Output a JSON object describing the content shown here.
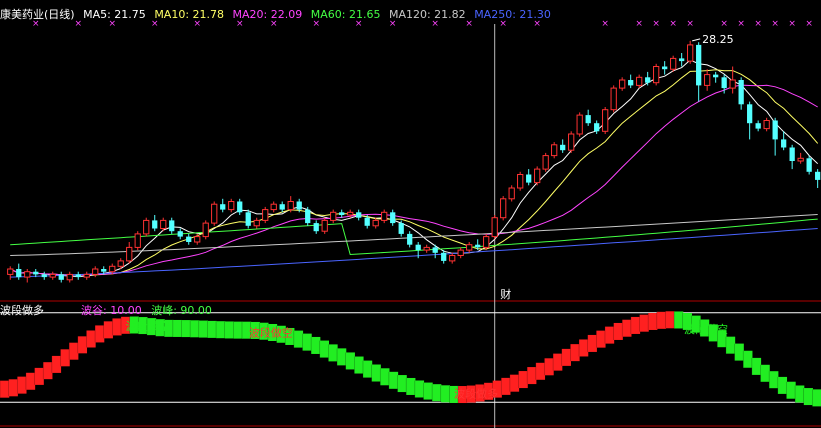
{
  "header": {
    "stock_label": "康美药业(日线)",
    "ma": [
      {
        "label": "MA5: 21.75",
        "color": "#ffffff"
      },
      {
        "label": "MA10: 21.78",
        "color": "#ffff66"
      },
      {
        "label": "MA20: 22.09",
        "color": "#ff44ff"
      },
      {
        "label": "MA60: 21.65",
        "color": "#44ff44"
      },
      {
        "label": "MA120: 21.82",
        "color": "#c8c8c8"
      },
      {
        "label": "MA250: 21.30",
        "color": "#4a64ff"
      }
    ]
  },
  "indicator": {
    "name": "波段做多",
    "trough": "波谷: 10.00",
    "peak": "波峰: 90.00",
    "trough_color": "#ff44ff",
    "peak_color": "#44ff44"
  },
  "colors": {
    "up": "#ff3232",
    "down": "#54ffff",
    "bg": "#000000",
    "frame": "#b00000",
    "ind_up": "#ff2020",
    "ind_down": "#22ee22"
  },
  "chart_data": [
    {
      "type": "candlestick",
      "title": "康美药业(日线)",
      "ylim": [
        18.8,
        28.8
      ],
      "high_label": "28.25",
      "event_marker": "财",
      "signal_marker": "×",
      "candles": [
        [
          19.6,
          19.8,
          19.4,
          19.9
        ],
        [
          19.8,
          19.5,
          19.4,
          20.0
        ],
        [
          19.5,
          19.7,
          19.3,
          19.8
        ],
        [
          19.7,
          19.6,
          19.5,
          19.8
        ],
        [
          19.6,
          19.5,
          19.4,
          19.7
        ],
        [
          19.5,
          19.6,
          19.4,
          19.7
        ],
        [
          19.6,
          19.4,
          19.3,
          19.7
        ],
        [
          19.4,
          19.6,
          19.3,
          19.7
        ],
        [
          19.6,
          19.5,
          19.4,
          19.7
        ],
        [
          19.5,
          19.6,
          19.4,
          19.7
        ],
        [
          19.6,
          19.8,
          19.5,
          19.9
        ],
        [
          19.8,
          19.7,
          19.6,
          19.9
        ],
        [
          19.7,
          19.9,
          19.6,
          20.0
        ],
        [
          19.9,
          20.1,
          19.8,
          20.2
        ],
        [
          20.1,
          20.6,
          20.0,
          20.8
        ],
        [
          20.6,
          21.1,
          20.5,
          21.2
        ],
        [
          21.1,
          21.6,
          21.0,
          21.7
        ],
        [
          21.6,
          21.3,
          21.2,
          21.8
        ],
        [
          21.3,
          21.6,
          21.2,
          21.7
        ],
        [
          21.6,
          21.2,
          21.1,
          21.7
        ],
        [
          21.2,
          21.0,
          20.9,
          21.3
        ],
        [
          21.0,
          20.8,
          20.7,
          21.1
        ],
        [
          20.8,
          21.0,
          20.7,
          21.1
        ],
        [
          21.0,
          21.5,
          20.9,
          21.6
        ],
        [
          21.5,
          22.2,
          21.4,
          22.3
        ],
        [
          22.2,
          22.0,
          21.9,
          22.4
        ],
        [
          22.0,
          22.3,
          21.9,
          22.4
        ],
        [
          22.3,
          21.9,
          21.8,
          22.4
        ],
        [
          21.9,
          21.4,
          21.3,
          22.0
        ],
        [
          21.4,
          21.6,
          21.3,
          21.7
        ],
        [
          21.6,
          22.0,
          21.5,
          22.1
        ],
        [
          22.0,
          22.2,
          21.9,
          22.3
        ],
        [
          22.2,
          22.0,
          21.9,
          22.3
        ],
        [
          22.0,
          22.3,
          21.9,
          22.5
        ],
        [
          22.3,
          22.0,
          21.9,
          22.4
        ],
        [
          22.0,
          21.5,
          21.4,
          22.1
        ],
        [
          21.5,
          21.2,
          21.1,
          21.6
        ],
        [
          21.2,
          21.6,
          21.1,
          21.7
        ],
        [
          21.6,
          21.9,
          21.5,
          22.0
        ],
        [
          21.9,
          21.8,
          21.7,
          22.0
        ],
        [
          21.8,
          21.9,
          21.7,
          22.0
        ],
        [
          21.9,
          21.7,
          21.6,
          22.0
        ],
        [
          21.7,
          21.4,
          21.3,
          21.8
        ],
        [
          21.4,
          21.6,
          21.3,
          21.7
        ],
        [
          21.6,
          21.9,
          21.5,
          22.0
        ],
        [
          21.9,
          21.5,
          21.4,
          22.0
        ],
        [
          21.5,
          21.1,
          21.0,
          21.6
        ],
        [
          21.1,
          20.7,
          20.6,
          21.2
        ],
        [
          20.7,
          20.5,
          20.2,
          20.8
        ],
        [
          20.5,
          20.6,
          20.4,
          20.7
        ],
        [
          20.6,
          20.4,
          20.2,
          20.7
        ],
        [
          20.4,
          20.1,
          20.0,
          20.5
        ],
        [
          20.1,
          20.3,
          20.0,
          20.4
        ],
        [
          20.3,
          20.5,
          20.2,
          20.6
        ],
        [
          20.5,
          20.7,
          20.4,
          20.8
        ],
        [
          20.7,
          20.6,
          20.5,
          20.9
        ],
        [
          20.6,
          21.0,
          20.5,
          21.1
        ],
        [
          21.0,
          21.7,
          20.9,
          21.8
        ],
        [
          21.7,
          22.4,
          21.6,
          22.5
        ],
        [
          22.4,
          22.8,
          22.3,
          22.9
        ],
        [
          22.8,
          23.3,
          22.7,
          23.4
        ],
        [
          23.3,
          23.0,
          22.9,
          23.5
        ],
        [
          23.0,
          23.5,
          22.9,
          23.6
        ],
        [
          23.5,
          24.0,
          23.4,
          24.1
        ],
        [
          24.0,
          24.4,
          23.9,
          24.5
        ],
        [
          24.4,
          24.2,
          24.1,
          24.6
        ],
        [
          24.2,
          24.8,
          24.1,
          24.9
        ],
        [
          24.8,
          25.5,
          24.7,
          25.6
        ],
        [
          25.5,
          25.2,
          25.1,
          25.7
        ],
        [
          25.2,
          24.9,
          24.8,
          25.3
        ],
        [
          24.9,
          25.7,
          24.8,
          25.8
        ],
        [
          25.7,
          26.5,
          25.6,
          26.6
        ],
        [
          26.5,
          26.8,
          26.4,
          26.9
        ],
        [
          26.8,
          26.6,
          26.5,
          27.0
        ],
        [
          26.6,
          26.9,
          26.5,
          27.0
        ],
        [
          26.9,
          26.7,
          26.6,
          27.1
        ],
        [
          26.7,
          27.3,
          26.6,
          27.4
        ],
        [
          27.3,
          27.2,
          27.0,
          27.5
        ],
        [
          27.2,
          27.6,
          27.1,
          27.7
        ],
        [
          27.6,
          27.5,
          27.3,
          27.8
        ],
        [
          27.5,
          28.1,
          27.4,
          28.25
        ],
        [
          28.1,
          26.6,
          26.0,
          28.2
        ],
        [
          26.6,
          27.0,
          26.4,
          27.2
        ],
        [
          27.0,
          26.9,
          26.7,
          27.1
        ],
        [
          26.9,
          26.5,
          26.3,
          27.0
        ],
        [
          26.5,
          26.8,
          26.3,
          27.3
        ],
        [
          26.8,
          25.9,
          25.7,
          26.9
        ],
        [
          25.9,
          25.2,
          24.6,
          26.0
        ],
        [
          25.2,
          25.0,
          24.9,
          25.3
        ],
        [
          25.0,
          25.3,
          24.9,
          25.4
        ],
        [
          25.3,
          24.6,
          24.0,
          25.4
        ],
        [
          24.6,
          24.3,
          24.2,
          24.9
        ],
        [
          24.3,
          23.8,
          23.5,
          24.4
        ],
        [
          23.8,
          23.9,
          23.7,
          24.1
        ],
        [
          23.9,
          23.4,
          23.3,
          24.0
        ],
        [
          23.4,
          23.1,
          22.8,
          23.5
        ]
      ],
      "ma_values": {
        "MA5": 21.75,
        "MA10": 21.78,
        "MA20": 22.09,
        "MA60": 21.65,
        "MA120": 21.82,
        "MA250": 21.3
      }
    },
    {
      "type": "bar",
      "title": "波段做多",
      "ylim": [
        0,
        100
      ],
      "trough": 10.0,
      "peak": 90.0,
      "annotations": [
        {
          "text": "波段做空",
          "at": 0.18,
          "color": "#22ee22"
        },
        {
          "text": "波段做空",
          "at": 0.33,
          "color": "#ff3333"
        },
        {
          "text": "波段做多",
          "at": 0.58,
          "color": "#ff3333"
        },
        {
          "text": "波段做空",
          "at": 0.86,
          "color": "#22ee22"
        }
      ],
      "segments": [
        {
          "from": 0.0,
          "to": 0.16,
          "v0": 18,
          "v1": 92,
          "trend": "up"
        },
        {
          "from": 0.16,
          "to": 0.21,
          "v0": 92,
          "v1": 88,
          "trend": "down"
        },
        {
          "from": 0.21,
          "to": 0.3,
          "v0": 88,
          "v1": 86,
          "trend": "down"
        },
        {
          "from": 0.3,
          "to": 0.56,
          "v0": 86,
          "v1": 12,
          "trend": "down"
        },
        {
          "from": 0.56,
          "to": 0.82,
          "v0": 12,
          "v1": 98,
          "trend": "up"
        },
        {
          "from": 0.82,
          "to": 1.0,
          "v0": 98,
          "v1": 8,
          "trend": "down"
        }
      ]
    }
  ]
}
